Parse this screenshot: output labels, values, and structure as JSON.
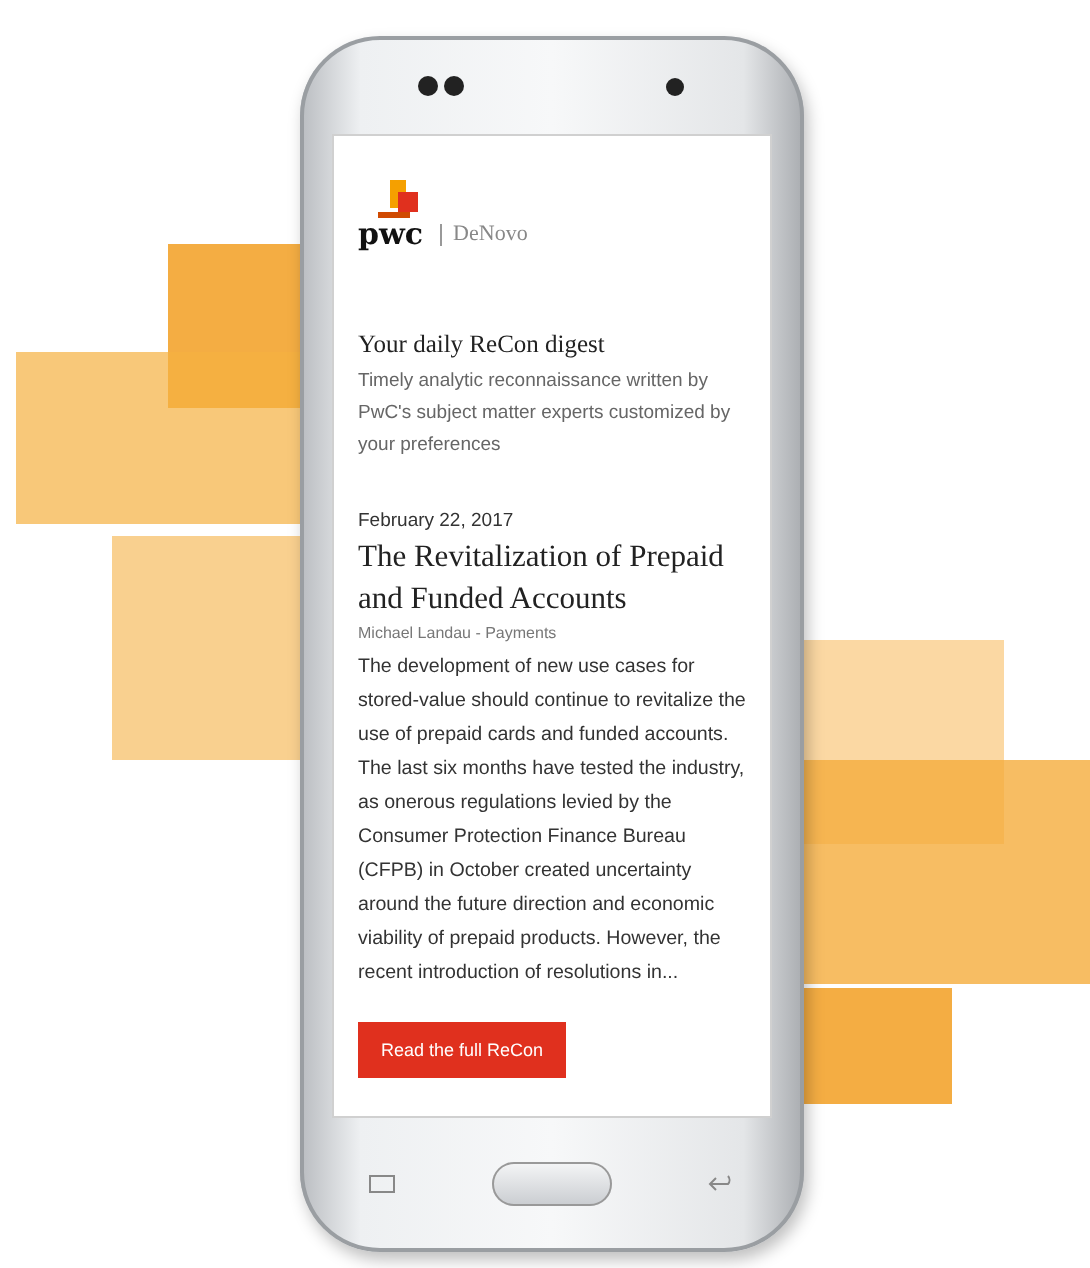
{
  "header": {
    "logo": "pwc",
    "product": "DeNovo"
  },
  "intro": {
    "title": "Your daily ReCon digest",
    "description": "Timely analytic reconnaissance written by PwC's subject matter experts customized by your preferences"
  },
  "article": {
    "date": "February 22, 2017",
    "title": "The Revitalization of Prepaid and Funded Accounts",
    "byline": "Michael Landau - Payments",
    "summary": "The development of new use cases for stored-value should continue to revitalize the use of prepaid cards and funded accounts. The last six months have tested the industry, as onerous regulations levied by the Consumer Protection Finance Bureau (CFPB) in October created uncertainty around the future direction and economic viability of prepaid products. However, the recent introduction of resolutions in..."
  },
  "button": "Read the full ReCon"
}
